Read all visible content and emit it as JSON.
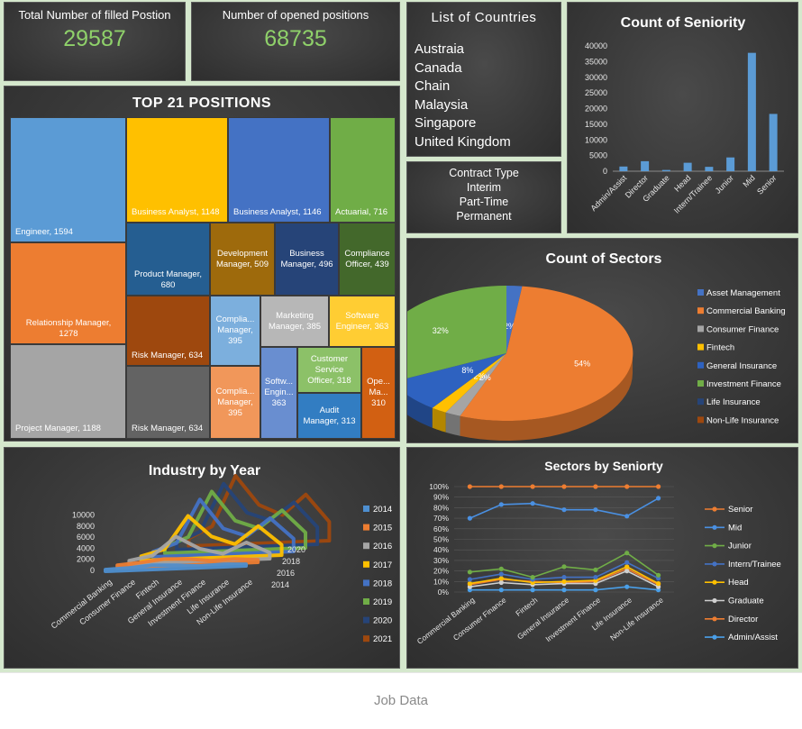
{
  "kpi": {
    "filled_label": "Total Number of filled Postion",
    "filled_value": "29587",
    "opened_label": "Number of opened positions",
    "opened_value": "68735"
  },
  "countries": {
    "title": "List of Countries",
    "items": [
      "Austraia",
      "Canada",
      "Chain",
      "Malaysia",
      "Singapore",
      "United Kingdom"
    ]
  },
  "contract": {
    "title": "Contract Type",
    "items": [
      "Interim",
      "Part-Time",
      "Permanent"
    ]
  },
  "footer": {
    "label": "Job Data"
  },
  "colors": {
    "kpi_value": "#8fd16a",
    "panel_bg": "#3a3a3a",
    "page_bg": "#d5e8cd",
    "bar": "#5b9bd5"
  },
  "chart_data": [
    {
      "id": "seniority",
      "type": "bar",
      "title": "Count of Seniority",
      "categories": [
        "Admin/Assist",
        "Director",
        "Graduate",
        "Head",
        "Intern/Trainee",
        "Junior",
        "Mid",
        "Senior"
      ],
      "values": [
        1500,
        3200,
        400,
        2700,
        1400,
        4400,
        37800,
        18300
      ],
      "ylim": [
        0,
        40000
      ],
      "yticks": [
        "0",
        "5000",
        "10000",
        "15000",
        "20000",
        "25000",
        "30000",
        "35000",
        "40000"
      ],
      "grid": false,
      "color": "#5b9bd5"
    },
    {
      "id": "positions",
      "type": "treemap",
      "title": "TOP 21 POSITIONS",
      "items": [
        {
          "label": "Engineer, 1594",
          "value": 1594,
          "color": "#5b9bd5"
        },
        {
          "label": "Relationship Manager, 1278",
          "value": 1278,
          "color": "#ed7d31"
        },
        {
          "label": "Project Manager, 1188",
          "value": 1188,
          "color": "#a5a5a5"
        },
        {
          "label": "Business Analyst, 1148",
          "value": 1148,
          "color": "#ffc000"
        },
        {
          "label": "Business Analyst, 1146",
          "value": 1146,
          "color": "#4472c4"
        },
        {
          "label": "Actuarial, 716",
          "value": 716,
          "color": "#70ad47"
        },
        {
          "label": "Product Manager, 680",
          "value": 680,
          "color": "#255e91"
        },
        {
          "label": "Development Manager, 509",
          "value": 509,
          "color": "#9e6a0c"
        },
        {
          "label": "Business Manager, 496",
          "value": 496,
          "color": "#264478"
        },
        {
          "label": "Compliance Officer, 439",
          "value": 439,
          "color": "#43682b"
        },
        {
          "label": "Risk Manager, 634",
          "value": 634,
          "color": "#9e480e"
        },
        {
          "label": "Risk Manager, 634",
          "value": 634,
          "color": "#636363"
        },
        {
          "label": "Complia... Manager, 395",
          "value": 395,
          "color": "#7cafdd"
        },
        {
          "label": "Marketing Manager, 385",
          "value": 385,
          "color": "#b7b7b7"
        },
        {
          "label": "Software Engineer, 363",
          "value": 363,
          "color": "#ffcd33"
        },
        {
          "label": "Complia... Manager, 395",
          "value": 395,
          "color": "#f1975a"
        },
        {
          "label": "Softw... Engin... 363",
          "value": 363,
          "color": "#698ed0"
        },
        {
          "label": "Customer Service Officer, 318",
          "value": 318,
          "color": "#8cc168"
        },
        {
          "label": "Audit Manager, 313",
          "value": 313,
          "color": "#327dc2"
        },
        {
          "label": "Ope... Ma... 310",
          "value": 310,
          "color": "#d26012"
        }
      ]
    },
    {
      "id": "sectors",
      "type": "pie",
      "title": "Count of Sectors",
      "slices": [
        {
          "name": "Asset Management",
          "value": 2,
          "label": "2%",
          "color": "#4472c4"
        },
        {
          "name": "Commercial Banking",
          "value": 54,
          "label": "54%",
          "color": "#ed7d31"
        },
        {
          "name": "Consumer Finance",
          "value": 2,
          "label": "2%",
          "color": "#a5a5a5"
        },
        {
          "name": "Fintech",
          "value": 2,
          "label": "2%",
          "color": "#ffc000"
        },
        {
          "name": "General Insurance",
          "value": 8,
          "label": "8%",
          "color": "#2e62c0"
        },
        {
          "name": "Investment Finance",
          "value": 32,
          "label": "32%",
          "color": "#70ad47"
        },
        {
          "name": "Life Insurance",
          "value": 0,
          "label": "0%",
          "color": "#264478"
        },
        {
          "name": "Non-Life Insurance",
          "value": 0,
          "label": "0%",
          "color": "#9e480e"
        }
      ],
      "legend": "right"
    },
    {
      "id": "industry",
      "type": "area",
      "title": "Industry by Year",
      "categories": [
        "Commercial Banking",
        "Consumer Finance",
        "Fintech",
        "General Insurance",
        "Investment Finance",
        "Life Insurance",
        "Non-Life Insurance"
      ],
      "yticks": [
        "0",
        "2000",
        "4000",
        "6000",
        "8000",
        "10000"
      ],
      "depth_labels": [
        "2014",
        "2016",
        "2018",
        "2020"
      ],
      "series": [
        {
          "name": "2014",
          "color": "#4e8fd0",
          "values": [
            200,
            300,
            500,
            400,
            200,
            300,
            200
          ]
        },
        {
          "name": "2015",
          "color": "#ed7d31",
          "values": [
            300,
            500,
            800,
            700,
            400,
            500,
            300
          ]
        },
        {
          "name": "2016",
          "color": "#a5a5a5",
          "values": [
            400,
            900,
            3000,
            1500,
            800,
            2000,
            700
          ]
        },
        {
          "name": "2017",
          "color": "#ffc000",
          "values": [
            500,
            1200,
            5000,
            2500,
            1500,
            3500,
            1200
          ]
        },
        {
          "name": "2018",
          "color": "#4472c4",
          "values": [
            600,
            1500,
            6500,
            3000,
            2000,
            4000,
            1500
          ]
        },
        {
          "name": "2019",
          "color": "#70ad47",
          "values": [
            700,
            1800,
            7000,
            3500,
            2500,
            4500,
            1800
          ]
        },
        {
          "name": "2020",
          "color": "#264478",
          "values": [
            800,
            2000,
            7500,
            4000,
            3000,
            5000,
            2000
          ]
        },
        {
          "name": "2021",
          "color": "#9e480e",
          "values": [
            900,
            2200,
            8000,
            4500,
            3200,
            5500,
            2200
          ]
        }
      ]
    },
    {
      "id": "sector_seniority",
      "type": "line",
      "title": "Sectors by Seniorty",
      "categories": [
        "Commercial Banking",
        "Consumer Finance",
        "Fintech",
        "General Insurance",
        "Investment Finance",
        "Life Insurance",
        "Non-Life Insurance"
      ],
      "yticks": [
        "0%",
        "10%",
        "20%",
        "30%",
        "40%",
        "50%",
        "60%",
        "70%",
        "80%",
        "90%",
        "100%"
      ],
      "ylim": [
        0,
        100
      ],
      "series": [
        {
          "name": "Senior",
          "color": "#ed7d31",
          "values": [
            100,
            100,
            100,
            100,
            100,
            100,
            100
          ]
        },
        {
          "name": "Mid",
          "color": "#4a90e2",
          "values": [
            70,
            83,
            84,
            78,
            78,
            72,
            89
          ]
        },
        {
          "name": "Junior",
          "color": "#70ad47",
          "values": [
            19,
            22,
            14,
            24,
            21,
            37,
            16
          ]
        },
        {
          "name": "Intern/Trainee",
          "color": "#4472c4",
          "values": [
            12,
            17,
            12,
            14,
            14,
            28,
            13
          ]
        },
        {
          "name": "Head",
          "color": "#ffc000",
          "values": [
            8,
            13,
            9,
            10,
            11,
            24,
            8
          ]
        },
        {
          "name": "Graduate",
          "color": "#d0d0d0",
          "values": [
            5,
            9,
            7,
            8,
            8,
            20,
            5
          ]
        },
        {
          "name": "Director",
          "color": "#ed7d31",
          "values": [
            7,
            12,
            10,
            9,
            10,
            22,
            7
          ]
        },
        {
          "name": "Admin/Assist",
          "color": "#4a9fe8",
          "values": [
            2,
            2,
            2,
            2,
            2,
            5,
            2
          ]
        }
      ],
      "legend": "right"
    }
  ]
}
